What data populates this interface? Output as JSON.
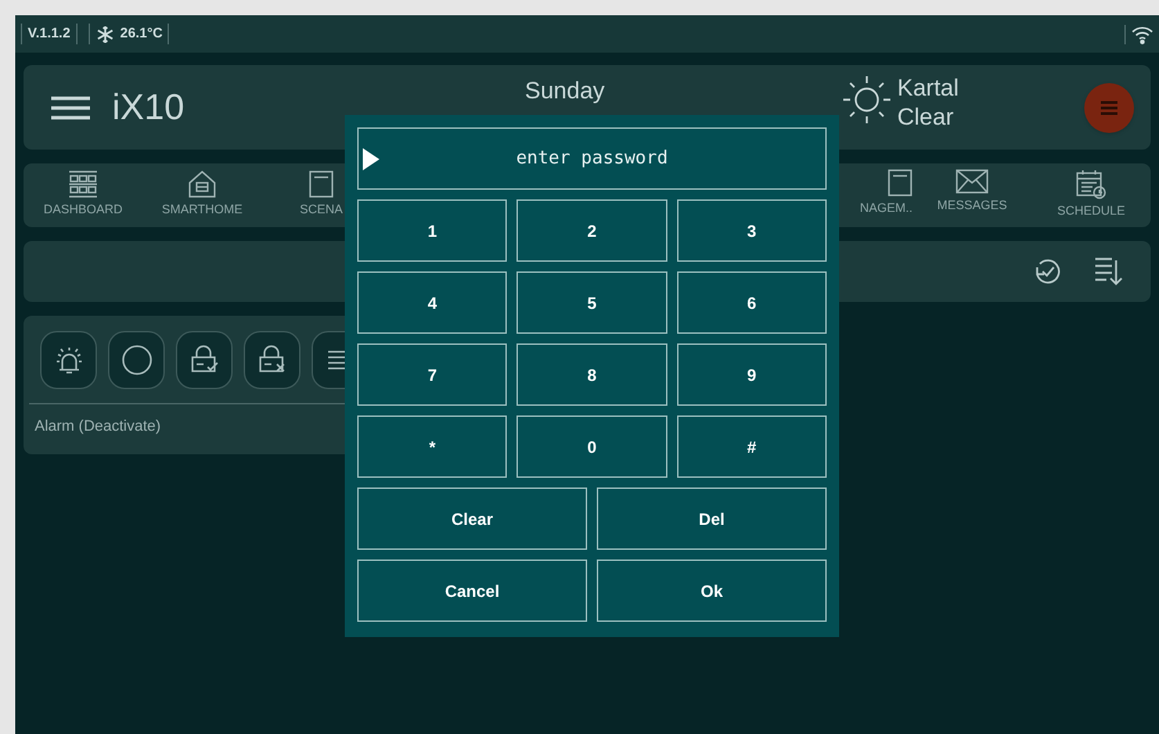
{
  "status_bar": {
    "version": "V.1.1.2",
    "temperature": "26.1°C"
  },
  "header": {
    "title": "iX10",
    "day": "Sunday",
    "location": "Kartal",
    "weather": "Clear"
  },
  "nav": {
    "left": [
      {
        "label": "DASHBOARD",
        "kind": "grid"
      },
      {
        "label": "SMARTHOME",
        "kind": "house"
      },
      {
        "label": "SCENA",
        "kind": "doc"
      }
    ],
    "right": [
      {
        "label": "NAGEM..",
        "kind": "doc"
      },
      {
        "label": "MESSAGES",
        "kind": "mail"
      },
      {
        "label": "SCHEDULE",
        "kind": "calendar"
      }
    ]
  },
  "alarm_panel": {
    "buttons": [
      {
        "kind": "siren"
      },
      {
        "kind": "circle"
      },
      {
        "kind": "lock-check"
      },
      {
        "kind": "lock-x"
      },
      {
        "kind": "list"
      }
    ],
    "label": "Alarm (Deactivate)"
  },
  "password_dialog": {
    "placeholder": "enter password",
    "keys": [
      "1",
      "2",
      "3",
      "4",
      "5",
      "6",
      "7",
      "8",
      "9",
      "*",
      "0",
      "#"
    ],
    "actions": [
      "Clear",
      "Del",
      "Cancel",
      "Ok"
    ]
  }
}
